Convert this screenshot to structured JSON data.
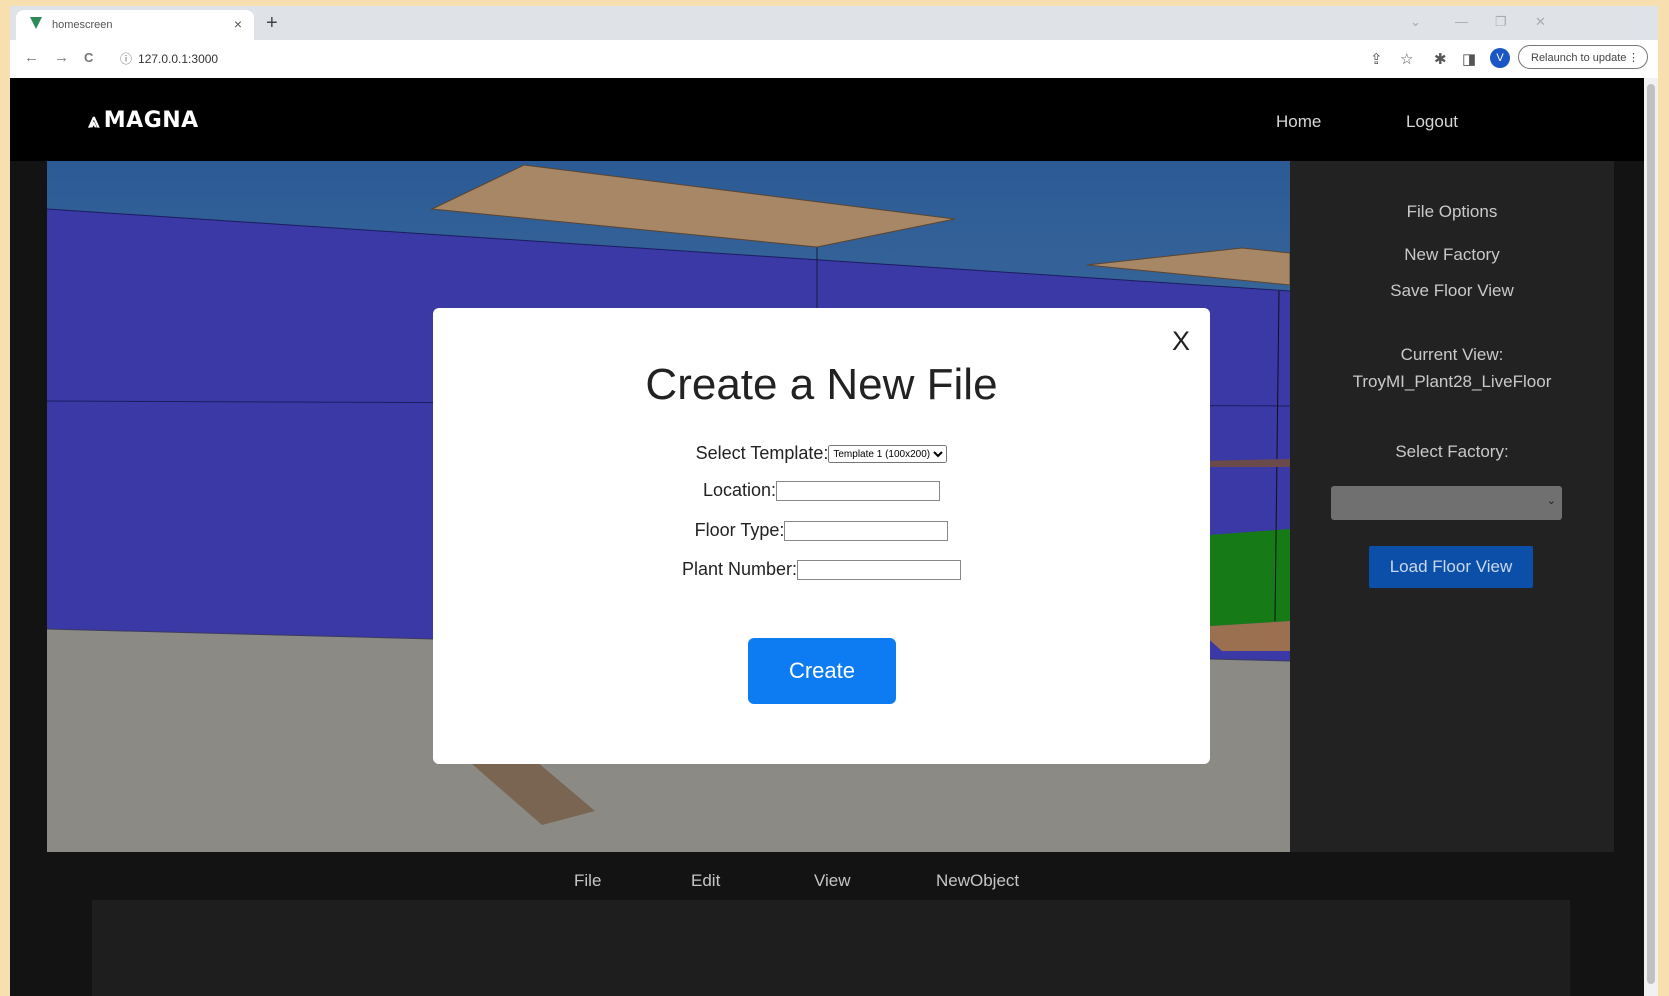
{
  "browser": {
    "tab_title": "homescreen",
    "tab_close": "×",
    "new_tab": "+",
    "back": "←",
    "forward": "→",
    "reload": "C",
    "url": "127.0.0.1:3000",
    "profile_initial": "V",
    "relaunch_label": "Relaunch to update"
  },
  "app_nav": {
    "brand": "MAGNA",
    "links": [
      "Home",
      "Logout"
    ]
  },
  "sidebar": {
    "file_options": "File Options",
    "new_factory": "New Factory",
    "save_floor_view": "Save Floor View",
    "current_view_label": "Current View:",
    "current_view_value": "TroyMI_Plant28_LiveFloor",
    "select_factory_label": "Select Factory:",
    "factory_selected": "",
    "load_button": "Load Floor View"
  },
  "bottom_menu": [
    "File",
    "Edit",
    "View",
    "NewObject"
  ],
  "modal": {
    "close": "X",
    "title": "Create a New File",
    "template_label": "Select Template:",
    "template_selected": "Template 1 (100x200)",
    "location_label": "Location:",
    "location_value": "",
    "floor_type_label": "Floor Type:",
    "floor_type_value": "",
    "plant_number_label": "Plant Number:",
    "plant_number_value": "",
    "create_button": "Create"
  }
}
